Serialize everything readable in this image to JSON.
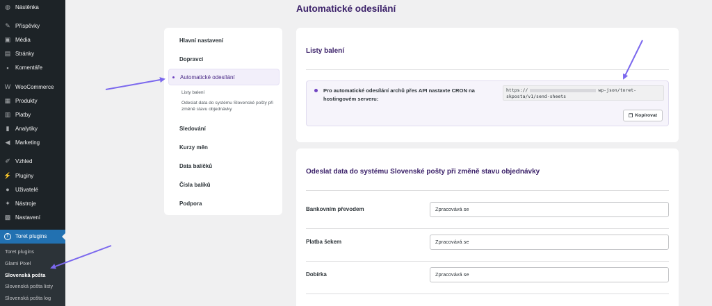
{
  "wp_menu": {
    "items": [
      {
        "label": "Nástěnka",
        "icon": "dashboard-icon",
        "glyph": "◍"
      },
      {
        "gap": true
      },
      {
        "label": "Příspěvky",
        "icon": "pin-icon",
        "glyph": "✎"
      },
      {
        "label": "Média",
        "icon": "media-icon",
        "glyph": "▣"
      },
      {
        "label": "Stránky",
        "icon": "pages-icon",
        "glyph": "▤"
      },
      {
        "label": "Komentáře",
        "icon": "comments-icon",
        "glyph": "▪"
      },
      {
        "gap": true
      },
      {
        "label": "WooCommerce",
        "icon": "woocommerce-icon",
        "glyph": "W"
      },
      {
        "label": "Produkty",
        "icon": "products-icon",
        "glyph": "▦"
      },
      {
        "label": "Platby",
        "icon": "payments-icon",
        "glyph": "▥"
      },
      {
        "label": "Analytiky",
        "icon": "analytics-icon",
        "glyph": "▮"
      },
      {
        "label": "Marketing",
        "icon": "marketing-icon",
        "glyph": "◀"
      },
      {
        "gap": true
      },
      {
        "label": "Vzhled",
        "icon": "appearance-icon",
        "glyph": "✐"
      },
      {
        "label": "Pluginy",
        "icon": "plugins-icon",
        "glyph": "⚡"
      },
      {
        "label": "Uživatelé",
        "icon": "users-icon",
        "glyph": "●"
      },
      {
        "label": "Nástroje",
        "icon": "tools-icon",
        "glyph": "✦"
      },
      {
        "label": "Nastavení",
        "icon": "settings-icon",
        "glyph": "▩"
      },
      {
        "gap": true
      },
      {
        "label": "Toret plugins",
        "icon": "toret-icon",
        "glyph": "T",
        "active": true
      }
    ],
    "submenu": [
      {
        "label": "Toret plugins"
      },
      {
        "label": "Glami Pixel"
      },
      {
        "label": "Slovenská pošta",
        "current": true
      },
      {
        "label": "Slovenská pošta listy"
      },
      {
        "label": "Slovenská pošta log"
      }
    ]
  },
  "page": {
    "title": "Automatické odesílání"
  },
  "settings_nav": {
    "items": [
      {
        "label": "Hlavní nastavení"
      },
      {
        "label": "Dopravci"
      },
      {
        "label": "Automatické odesílání",
        "active": true,
        "sub": [
          "Listy balení",
          "Odeslat data do systému Slovenské pošty při změně stavu objednávky"
        ]
      },
      {
        "label": "Sledování"
      },
      {
        "label": "Kurzy měn"
      },
      {
        "label": "Data balíčků"
      },
      {
        "label": "Čísla balíků"
      },
      {
        "label": "Podpora"
      }
    ]
  },
  "packing_lists": {
    "title": "Listy balení",
    "cron_text": "Pro automatické odesílání archů přes API nastavte CRON na hostingovém serveru:",
    "url_start": "https://",
    "url_end": "wp-json/toret-skposta/v1/send-sheets",
    "copy_label": "Kopírovat"
  },
  "status_section": {
    "title": "Odeslat data do systému Slovenské pošty při změně stavu objednávky",
    "rows": [
      {
        "label": "Bankovním převodem",
        "value": "Zpracovává se"
      },
      {
        "label": "Platba šekem",
        "value": "Zpracovává se"
      },
      {
        "label": "Dobírka",
        "value": "Zpracovává se"
      }
    ]
  },
  "colors": {
    "accent": "#3b2169",
    "arrow": "#7b68ee",
    "wp_active": "#2271b1"
  }
}
